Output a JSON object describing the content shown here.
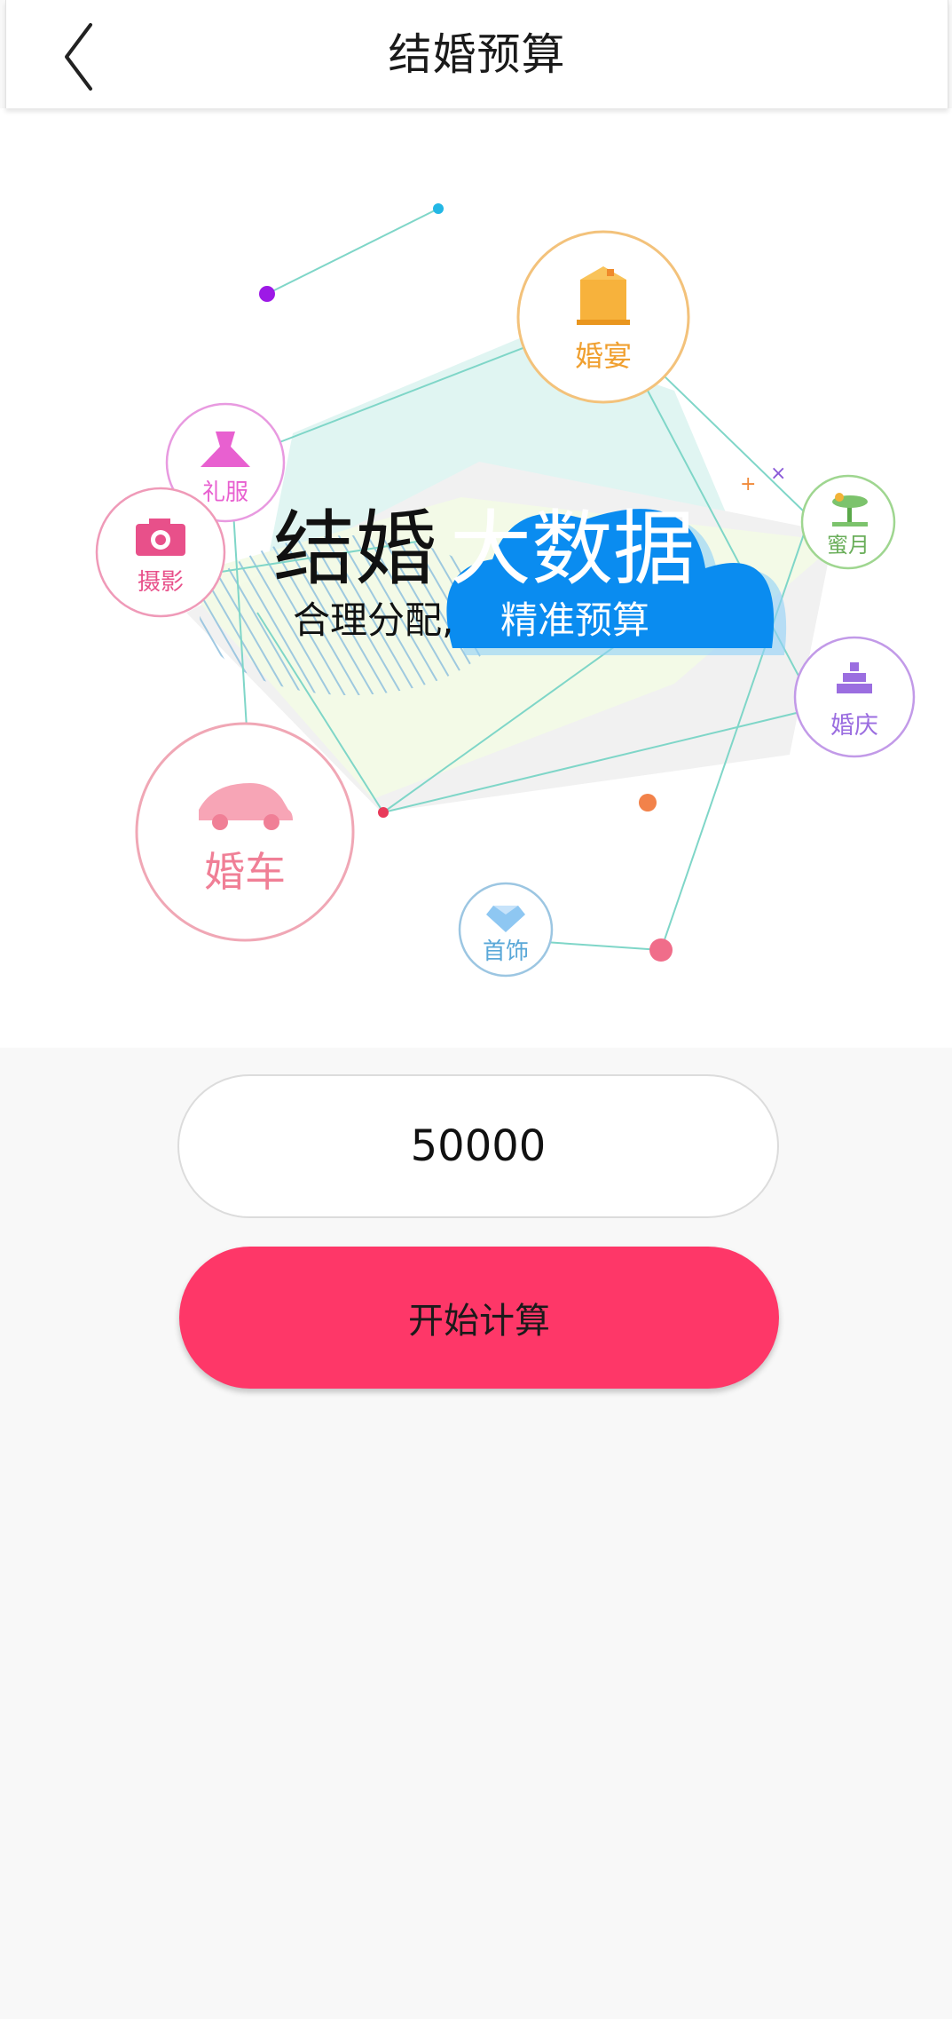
{
  "header": {
    "title": "结婚预算",
    "back_icon": "chevron-left-icon"
  },
  "hero": {
    "headline_part1": "结婚",
    "headline_part2": "大数据",
    "subline_part1": "合理分配,",
    "subline_part2": "精准预算",
    "categories": {
      "banquet": "婚宴",
      "dress": "礼服",
      "photo": "摄影",
      "honeymoon": "蜜月",
      "celebration": "婚庆",
      "car": "婚车",
      "jewelry": "首饰"
    },
    "colors": {
      "cloud": "#0a8cf0",
      "banquet": "#f0a030",
      "dress": "#e860d0",
      "photo": "#e8508a",
      "honeymoon": "#7cc36c",
      "celebration": "#9b6ee0",
      "car": "#f07f96",
      "jewelry": "#5aa8d8"
    }
  },
  "budget": {
    "value": "50000"
  },
  "actions": {
    "calculate_label": "开始计算",
    "accent_color": "#fe3768"
  }
}
